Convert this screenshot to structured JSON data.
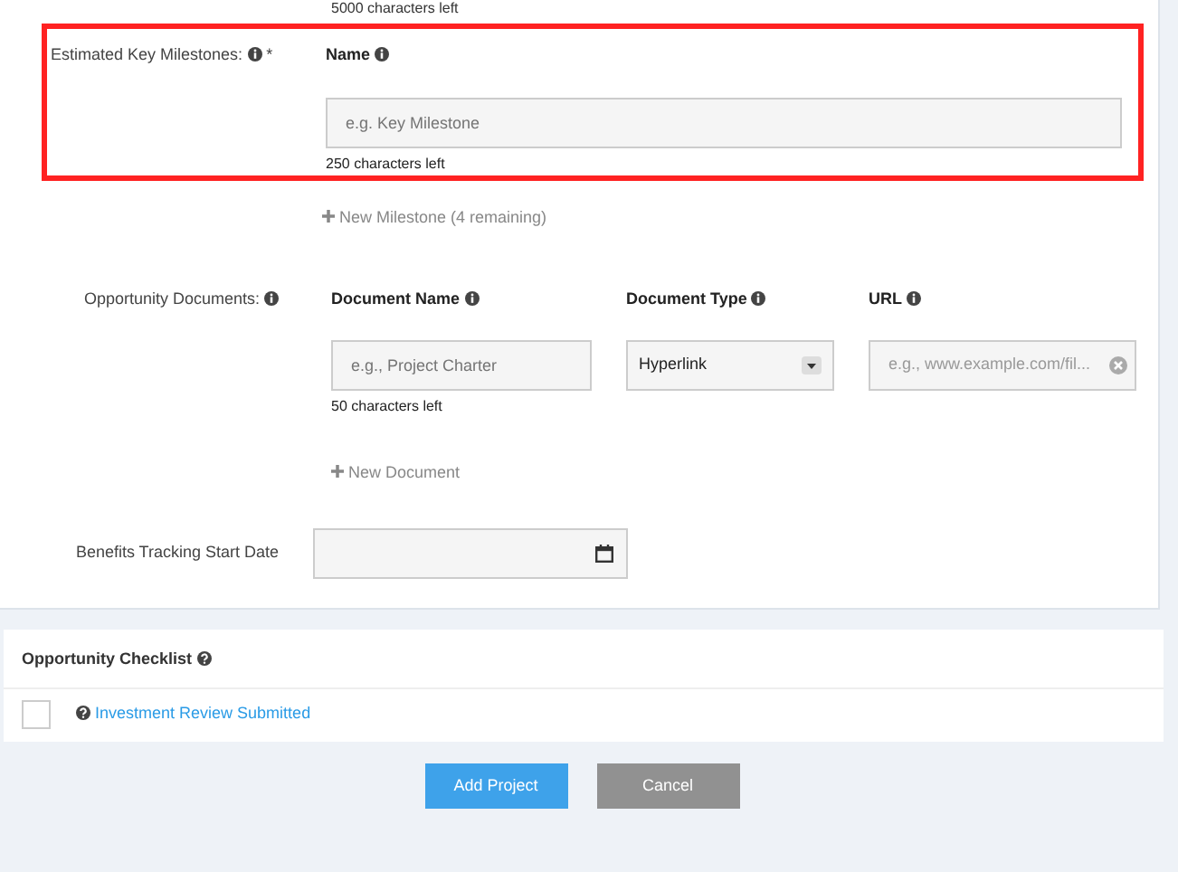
{
  "top_hint": "5000 characters left",
  "milestones": {
    "label": "Estimated Key Milestones:",
    "required_mark": "*",
    "column": "Name",
    "placeholder": "e.g. Key Milestone",
    "hint": "250 characters left",
    "add_link": "New Milestone (4 remaining)"
  },
  "documents": {
    "label": "Opportunity Documents:",
    "columns": [
      "Document Name",
      "Document Type",
      "URL"
    ],
    "name_placeholder": "e.g., Project Charter",
    "type_value": "Hyperlink",
    "url_placeholder": "e.g., www.example.com/fil...",
    "hint": "50 characters left",
    "add_link": "New Document"
  },
  "benefits_date": {
    "label": "Benefits Tracking Start Date"
  },
  "checklist": {
    "title": "Opportunity Checklist",
    "items": [
      {
        "label": "Investment Review Submitted",
        "checked": false
      }
    ]
  },
  "buttons": [
    {
      "label": "Add Project",
      "kind": "primary"
    },
    {
      "label": "Cancel",
      "kind": "secondary"
    }
  ]
}
